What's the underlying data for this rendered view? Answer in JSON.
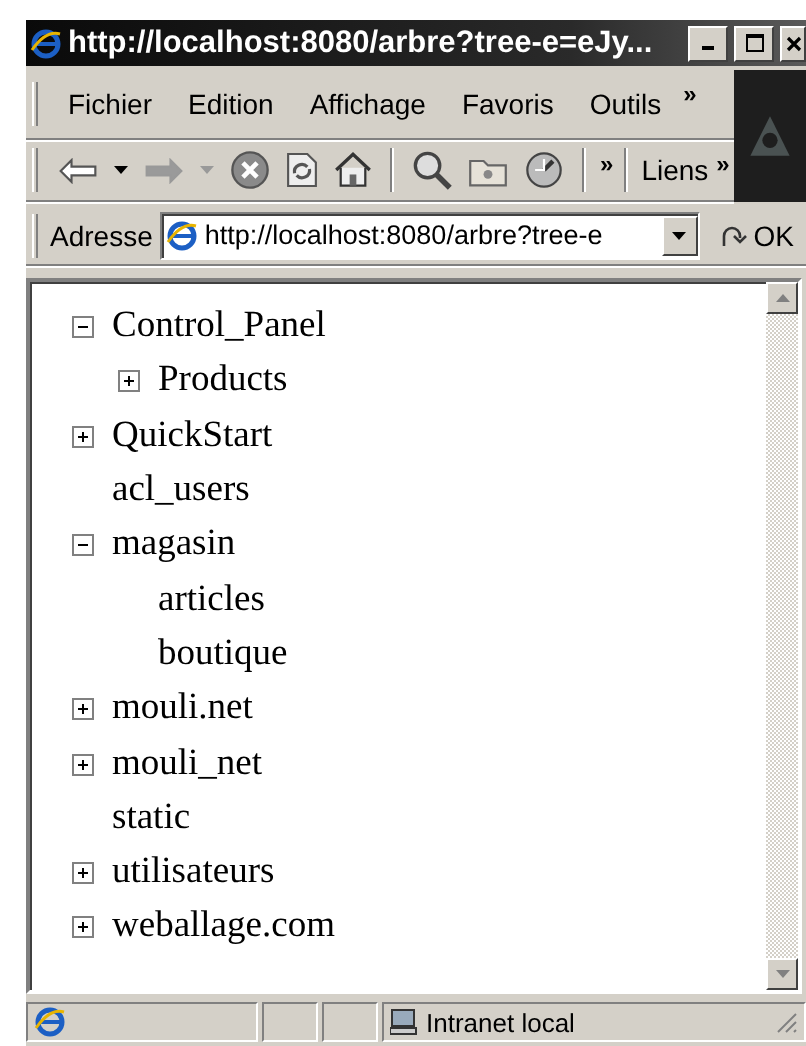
{
  "window": {
    "title": "http://localhost:8080/arbre?tree-e=eJy..."
  },
  "menu": [
    {
      "label": "Fichier"
    },
    {
      "label": "Edition"
    },
    {
      "label": "Affichage"
    },
    {
      "label": "Favoris"
    },
    {
      "label": "Outils"
    }
  ],
  "menu_more": "»",
  "toolbar": {
    "more": "»",
    "links": "Liens",
    "links_more": "»"
  },
  "address": {
    "label": "Adresse",
    "value": "http://localhost:8080/arbre?tree-e",
    "go": "OK"
  },
  "tree": [
    {
      "label": "Control_Panel",
      "kind": "folder",
      "expanded": true,
      "children": [
        {
          "label": "Products",
          "kind": "folder",
          "expanded": false
        }
      ]
    },
    {
      "label": "QuickStart",
      "kind": "folder",
      "expanded": false
    },
    {
      "label": "acl_users",
      "kind": "leaf"
    },
    {
      "label": "magasin",
      "kind": "folder",
      "expanded": true,
      "children": [
        {
          "label": "articles",
          "kind": "leaf"
        },
        {
          "label": "boutique",
          "kind": "leaf"
        }
      ]
    },
    {
      "label": "mouli.net",
      "kind": "folder",
      "expanded": false
    },
    {
      "label": "mouli_net",
      "kind": "folder",
      "expanded": false
    },
    {
      "label": "static",
      "kind": "leaf"
    },
    {
      "label": "utilisateurs",
      "kind": "folder",
      "expanded": false
    },
    {
      "label": "weballage.com",
      "kind": "folder",
      "expanded": false
    }
  ],
  "status_bar": {
    "zone": "Intranet local"
  }
}
